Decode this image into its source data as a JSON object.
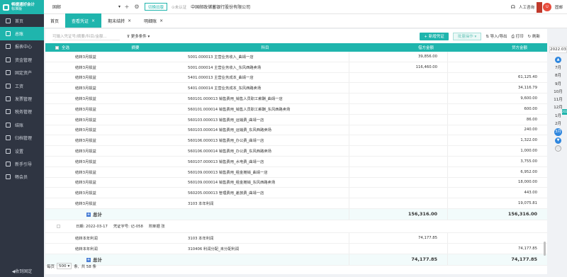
{
  "brand": {
    "name_line1": "畅捷通好会计",
    "name_line2": "标准版"
  },
  "sidebar": {
    "items": [
      {
        "label": "首页",
        "icon": "home-icon"
      },
      {
        "label": "总账",
        "icon": "ledger-icon",
        "active": true
      },
      {
        "label": "报表中心",
        "icon": "report-icon"
      },
      {
        "label": "资金管理",
        "icon": "money-icon"
      },
      {
        "label": "固定资产",
        "icon": "asset-icon"
      },
      {
        "label": "工资",
        "icon": "salary-icon"
      },
      {
        "label": "发票管理",
        "icon": "invoice-icon"
      },
      {
        "label": "税务管理",
        "icon": "tax-icon"
      },
      {
        "label": "结账",
        "icon": "close-account-icon"
      },
      {
        "label": "归档管理",
        "icon": "archive-icon"
      },
      {
        "label": "设置",
        "icon": "settings-icon"
      },
      {
        "label": "新手引导",
        "icon": "guide-icon"
      },
      {
        "label": "畅会员",
        "icon": "member-icon"
      }
    ],
    "collapse_label": "◀收到固定"
  },
  "topbar": {
    "account": "固邮",
    "switch_label": "切换旧版",
    "unverified": "⊙未认证",
    "company": "中国邮政储蓄银行股份有限公司",
    "service": "人工咨询",
    "user": "固邮"
  },
  "tabs": [
    {
      "label": "首页",
      "closable": false,
      "active": false
    },
    {
      "label": "查看凭证",
      "closable": true,
      "active": true
    },
    {
      "label": "期末结转",
      "closable": true,
      "active": false
    },
    {
      "label": "明细账",
      "closable": true,
      "active": false
    }
  ],
  "toolbar": {
    "search_placeholder": "可输入凭证号/摘要/科目/金额...",
    "more_filter": "更多条件",
    "new_voucher": "+ 新增凭证",
    "batch": "批量操作 ▾",
    "import_export": "导入/导出",
    "print": "打印",
    "refresh": "刷新"
  },
  "table": {
    "headers": {
      "select_all": "全选",
      "summary": "摘要",
      "subject": "科目",
      "debit": "借方金额",
      "credit": "贷方金额"
    },
    "rows": [
      {
        "summary": "结转3月损益",
        "subject": "5001.000013 主营业务收入_曲靖一店",
        "debit": "39,856.00",
        "credit": ""
      },
      {
        "summary": "结转3月损益",
        "subject": "5001.000014 主营业务收入_东风西路卖场",
        "debit": "116,460.00",
        "credit": ""
      },
      {
        "summary": "结转3月损益",
        "subject": "5401.000013 主营业务成本_曲靖一店",
        "debit": "",
        "credit": "61,125.40"
      },
      {
        "summary": "结转3月损益",
        "subject": "5401.000014 主营业务成本_东风西路卖场",
        "debit": "",
        "credit": "34,116.79"
      },
      {
        "summary": "结转3月损益",
        "subject": "560101.000013 销售费用_销售人员职工薪酬_曲靖一店",
        "debit": "",
        "credit": "9,600.00"
      },
      {
        "summary": "结转3月损益",
        "subject": "560101.000014 销售费用_销售人员职工薪酬_东风西路卖场",
        "debit": "",
        "credit": "600.00"
      },
      {
        "summary": "结转3月损益",
        "subject": "560103.000013 销售费用_运输费_曲靖一店",
        "debit": "",
        "credit": "86.00"
      },
      {
        "summary": "结转3月损益",
        "subject": "560103.000014 销售费用_运输费_东风西路卖场",
        "debit": "",
        "credit": "240.00"
      },
      {
        "summary": "结转3月损益",
        "subject": "560106.000013 销售费用_办公费_曲靖一店",
        "debit": "",
        "credit": "1,322.00"
      },
      {
        "summary": "结转3月损益",
        "subject": "560106.000014 销售费用_办公费_东风西路卖场",
        "debit": "",
        "credit": "1,000.00"
      },
      {
        "summary": "结转3月损益",
        "subject": "560107.000013 销售费用_水电费_曲靖一店",
        "debit": "",
        "credit": "3,755.00"
      },
      {
        "summary": "结转3月损益",
        "subject": "560109.000013 销售费用_租金摊销_曲靖一店",
        "debit": "",
        "credit": "6,952.00"
      },
      {
        "summary": "结转3月损益",
        "subject": "560109.000014 销售费用_租金摊销_东风西路卖场",
        "debit": "",
        "credit": "18,000.00"
      },
      {
        "summary": "结转3月损益",
        "subject": "560205.000013 管理费用_差旅费_曲靖一店",
        "debit": "",
        "credit": "443.00"
      },
      {
        "summary": "结转3月损益",
        "subject": "3103 本年利润",
        "debit": "",
        "credit": "19,075.81"
      }
    ],
    "total": {
      "label": "总计",
      "debit": "156,316.00",
      "credit": "156,316.00"
    },
    "voucher2": {
      "date": "日期: 2022-03-17",
      "number": "凭证字号: 记-058",
      "attachments": "附单据 张",
      "rows": [
        {
          "summary": "结转本年利润",
          "subject": "3103 本年利润",
          "debit": "74,177.85",
          "credit": ""
        },
        {
          "summary": "结转本年利润",
          "subject": "310406 利润分配_未分配利润",
          "debit": "",
          "credit": "74,177.85"
        }
      ],
      "total": {
        "label": "总计",
        "debit": "74,177.85",
        "credit": "74,177.85"
      }
    }
  },
  "pager": {
    "label": "每页",
    "size": "500",
    "unit": "条,",
    "total": "共 58 条"
  },
  "timeline": {
    "year": "2022.03",
    "months_top": [
      "7月",
      "8月",
      "9月",
      "10月",
      "11月",
      "12月"
    ],
    "year_mark": "2022",
    "months_bottom": [
      "1月",
      "2月"
    ],
    "current": "3月"
  }
}
